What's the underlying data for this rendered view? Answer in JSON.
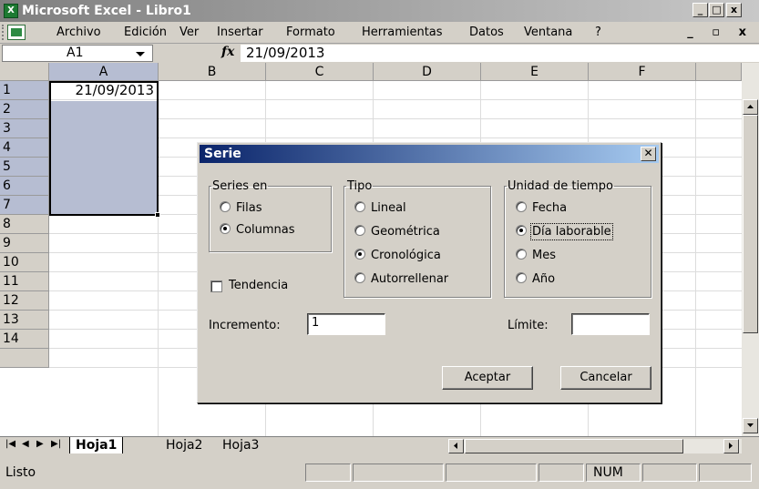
{
  "app": {
    "title": "Microsoft Excel - Libro1",
    "icon": "excel-icon"
  },
  "window_controls": {
    "minimize": "_",
    "restore": "□",
    "close": "x"
  },
  "menu": {
    "items": [
      {
        "label": "Archivo"
      },
      {
        "label": "Edición"
      },
      {
        "label": "Ver"
      },
      {
        "label": "Insertar"
      },
      {
        "label": "Formato"
      },
      {
        "label": "Herramientas"
      },
      {
        "label": "Datos"
      },
      {
        "label": "Ventana"
      },
      {
        "label": "?"
      }
    ],
    "mdi_controls": "_ ▫ x"
  },
  "formula_bar": {
    "name_box": "A1",
    "fx": "fx",
    "value": "21/09/2013"
  },
  "grid": {
    "columns": [
      "A",
      "B",
      "C",
      "D",
      "E",
      "F"
    ],
    "rows": [
      "1",
      "2",
      "3",
      "4",
      "5",
      "6",
      "7",
      "8",
      "9",
      "10",
      "11",
      "12",
      "13",
      "14"
    ],
    "cells": {
      "A1": "21/09/2013"
    },
    "selection": "A1:A7"
  },
  "sheets": {
    "tabs": [
      {
        "label": "Hoja1",
        "active": true
      },
      {
        "label": "Hoja2",
        "active": false
      },
      {
        "label": "Hoja3",
        "active": false
      }
    ]
  },
  "status": {
    "text": "Listo",
    "num": "NUM"
  },
  "dialog": {
    "title": "Serie",
    "series_group": {
      "legend": "Series en",
      "options": [
        {
          "label": "Filas",
          "checked": false
        },
        {
          "label": "Columnas",
          "checked": true
        }
      ]
    },
    "type_group": {
      "legend": "Tipo",
      "options": [
        {
          "label": "Lineal",
          "checked": false
        },
        {
          "label": "Geométrica",
          "checked": false
        },
        {
          "label": "Cronológica",
          "checked": true
        },
        {
          "label": "Autorrellenar",
          "checked": false
        }
      ]
    },
    "unit_group": {
      "legend": "Unidad de tiempo",
      "options": [
        {
          "label": "Fecha",
          "checked": false
        },
        {
          "label": "Día laborable",
          "checked": true
        },
        {
          "label": "Mes",
          "checked": false
        },
        {
          "label": "Año",
          "checked": false
        }
      ]
    },
    "trend_label": "Tendencia",
    "increment_label": "Incremento:",
    "increment_value": "1",
    "limit_label": "Límite:",
    "limit_value": "",
    "ok": "Aceptar",
    "cancel": "Cancelar"
  },
  "colors": {
    "selection": "#b6bdd2",
    "dialog_title_start": "#0a246a",
    "dialog_title_end": "#a6caf0"
  }
}
